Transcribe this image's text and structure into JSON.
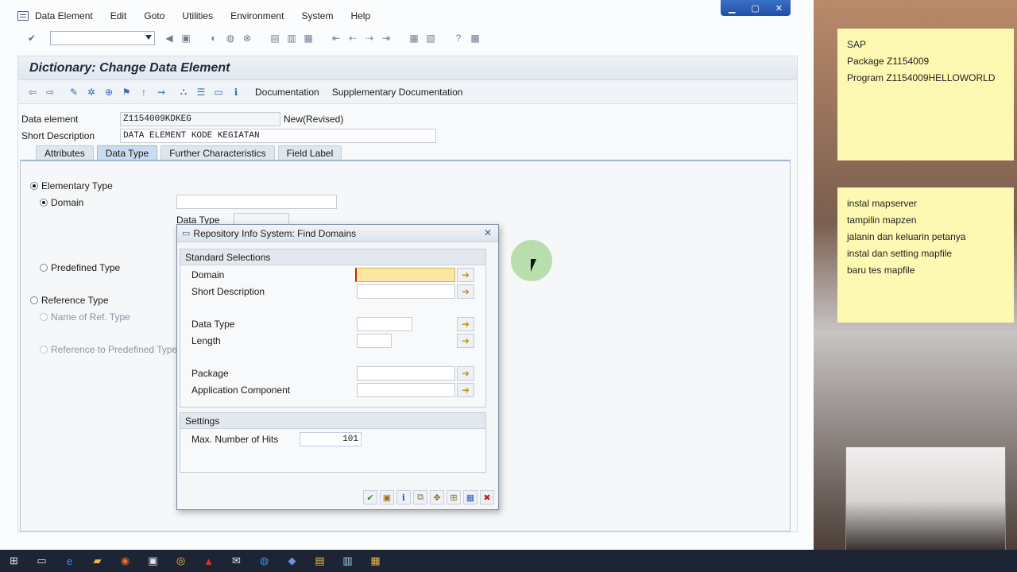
{
  "menubar": {
    "items": [
      "Data Element",
      "Edit",
      "Goto",
      "Utilities",
      "Environment",
      "System",
      "Help"
    ]
  },
  "screen": {
    "title": "Dictionary: Change Data Element",
    "toolbar_text_buttons": [
      "Documentation",
      "Supplementary Documentation"
    ],
    "data_element_label": "Data element",
    "data_element_value": "Z1154009KDKEG",
    "status": "New(Revised)",
    "short_desc_label": "Short Description",
    "short_desc_value": "DATA ELEMENT KODE KEGIATAN",
    "tabs": [
      "Attributes",
      "Data Type",
      "Further Characteristics",
      "Field Label"
    ],
    "active_tab": "Data Type",
    "elementary_type": "Elementary Type",
    "domain": "Domain",
    "data_type": "Data Type",
    "predefined_type": "Predefined Type",
    "reference_type": "Reference Type",
    "name_of_ref_type": "Name of Ref. Type",
    "ref_predefined": "Reference to Predefined Type"
  },
  "dialog": {
    "title": "Repository Info System: Find Domains",
    "standard_selections": "Standard Selections",
    "fields": {
      "domain": "Domain",
      "short_description": "Short Description",
      "data_type": "Data Type",
      "length": "Length",
      "package": "Package",
      "application_component": "Application Component"
    },
    "settings": "Settings",
    "max_hits_label": "Max. Number of Hits",
    "max_hits_value": "101"
  },
  "notes": {
    "note1": [
      "SAP",
      "Package Z1154009",
      "Program Z1154009HELLOWORLD"
    ],
    "note2": [
      "instal mapserver",
      "tampilin mapzen",
      "jalanin dan keluarin petanya",
      "instal dan setting mapfile",
      "baru tes mapfile"
    ]
  },
  "colors": {
    "focus_field": "#fbe6a3",
    "note_bg": "#fef9b2",
    "active_tab": "#c9dcf1"
  }
}
